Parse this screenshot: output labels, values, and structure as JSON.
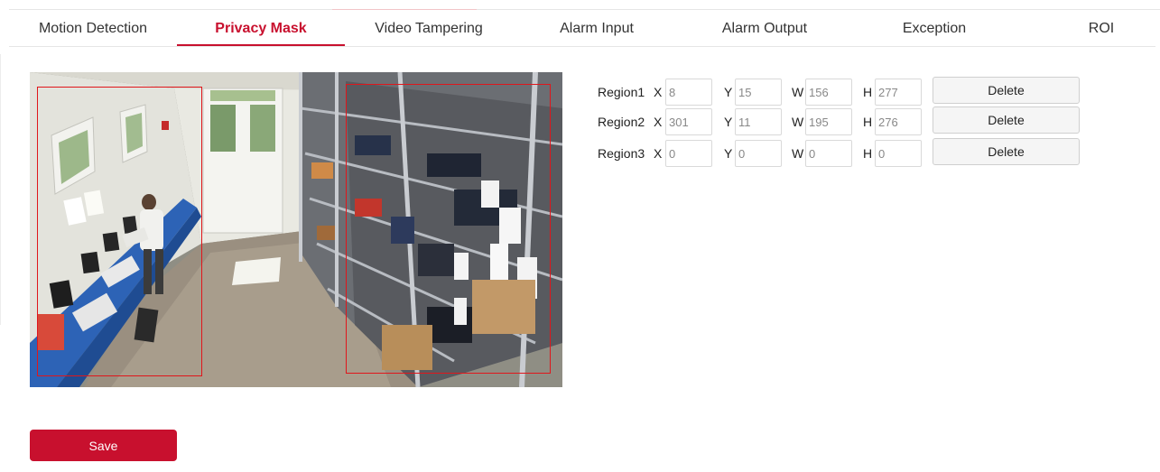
{
  "tabs": [
    {
      "label": "Motion Detection"
    },
    {
      "label": "Privacy Mask",
      "active": true
    },
    {
      "label": "Video Tampering"
    },
    {
      "label": "Alarm Input"
    },
    {
      "label": "Alarm Output"
    },
    {
      "label": "Exception"
    },
    {
      "label": "ROI"
    }
  ],
  "regions": [
    {
      "label": "Region1",
      "x_label": "X",
      "x": "8",
      "y_label": "Y",
      "y": "15",
      "w_label": "W",
      "w": "156",
      "h_label": "H",
      "h": "277",
      "delete_label": "Delete"
    },
    {
      "label": "Region2",
      "x_label": "X",
      "x": "301",
      "y_label": "Y",
      "y": "11",
      "w_label": "W",
      "w": "195",
      "h_label": "H",
      "h": "276",
      "delete_label": "Delete"
    },
    {
      "label": "Region3",
      "x_label": "X",
      "x": "0",
      "y_label": "Y",
      "y": "0",
      "w_label": "W",
      "w": "0",
      "h_label": "H",
      "h": "0",
      "delete_label": "Delete"
    }
  ],
  "save_label": "Save",
  "colors": {
    "accent": "#c8102e",
    "mask_border": "#e0161b"
  }
}
